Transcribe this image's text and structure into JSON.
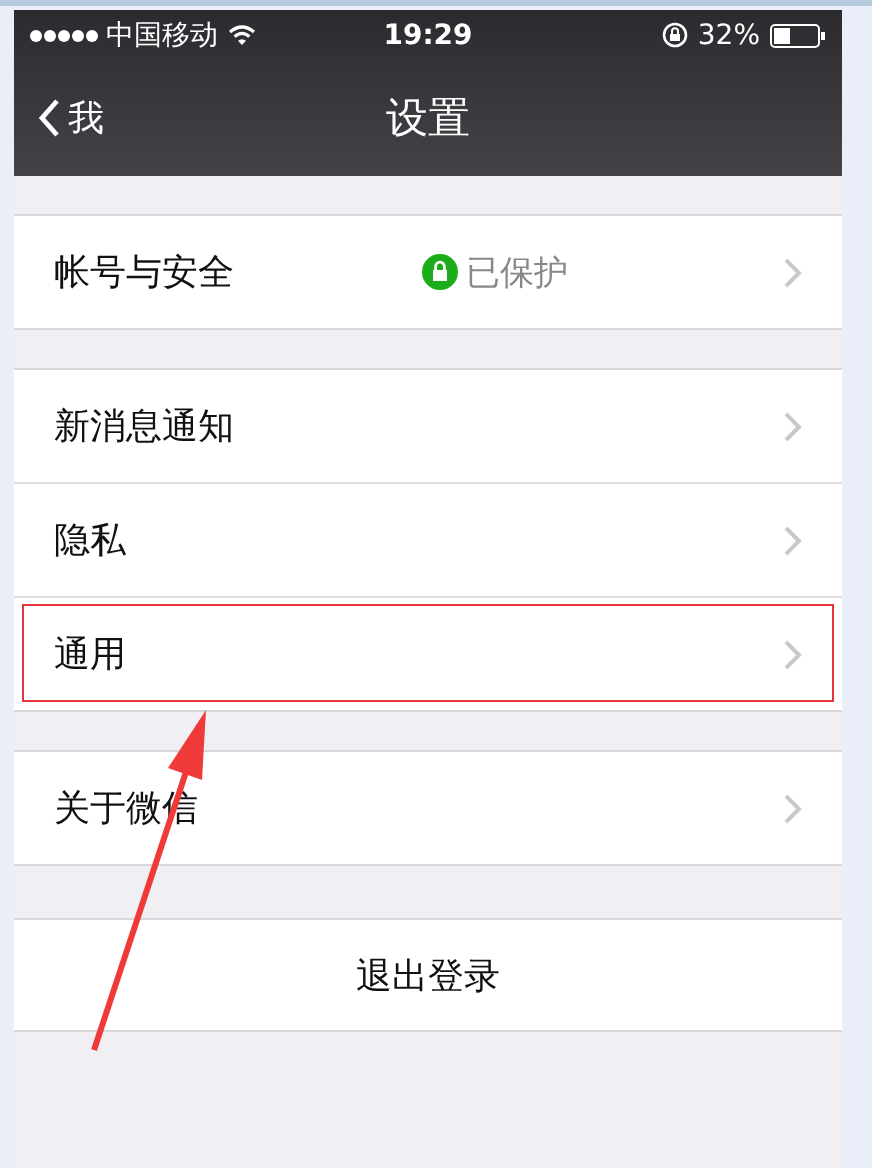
{
  "status_bar": {
    "carrier": "中国移动",
    "time": "19:29",
    "battery": "32%"
  },
  "nav": {
    "back": "我",
    "title": "设置"
  },
  "groups": [
    {
      "items": [
        {
          "label": "帐号与安全",
          "value": "已保护",
          "highlighted": false
        }
      ]
    },
    {
      "items": [
        {
          "label": "新消息通知",
          "highlighted": false
        },
        {
          "label": "隐私",
          "highlighted": false
        },
        {
          "label": "通用",
          "highlighted": true
        }
      ]
    },
    {
      "items": [
        {
          "label": "关于微信",
          "highlighted": false
        }
      ]
    }
  ],
  "logout": "退出登录"
}
